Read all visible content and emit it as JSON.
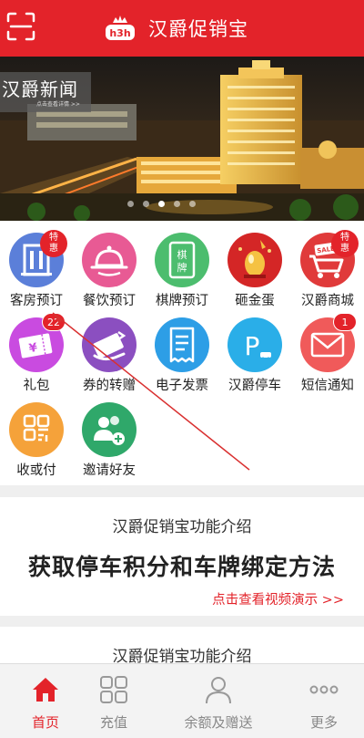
{
  "colors": {
    "brand": "#e3232a",
    "tab_inactive": "#888888"
  },
  "header": {
    "title": "汉爵促销宝",
    "logo_text": "h3h",
    "scan_icon": "scan-icon"
  },
  "banner": {
    "news_title": "汉爵新闻",
    "news_subtitle": "点击查看详情 >>",
    "slide_count": 5,
    "active_slide": 2
  },
  "grid": {
    "items": [
      {
        "label": "客房预订",
        "icon": "hotel-building-icon",
        "color": "#5b7fd9",
        "badge": "特惠"
      },
      {
        "label": "餐饮预订",
        "icon": "food-cloche-icon",
        "color": "#e85a94"
      },
      {
        "label": "棋牌预订",
        "icon": "chess-card-icon",
        "color": "#4cbd6e",
        "icon_text": "棋牌"
      },
      {
        "label": "砸金蛋",
        "icon": "golden-egg-icon",
        "color": "#d42626"
      },
      {
        "label": "汉爵商城",
        "icon": "cart-sale-icon",
        "color": "#e03a3a",
        "badge": "特惠",
        "icon_text": "SALE"
      },
      {
        "label": "礼包",
        "icon": "gift-voucher-icon",
        "color": "#c94be0",
        "badge": "22"
      },
      {
        "label": "券的转赠",
        "icon": "coupon-transfer-icon",
        "color": "#8b4fc0"
      },
      {
        "label": "电子发票",
        "icon": "invoice-icon",
        "color": "#2d9ee6"
      },
      {
        "label": "汉爵停车",
        "icon": "parking-icon",
        "color": "#2aaee8",
        "icon_text": "P"
      },
      {
        "label": "短信通知",
        "icon": "sms-envelope-icon",
        "color": "#f05a5a",
        "badge": "1"
      },
      {
        "label": "收或付",
        "icon": "qr-pay-icon",
        "color": "#f5a23a"
      },
      {
        "label": "邀请好友",
        "icon": "invite-friends-icon",
        "color": "#2fa86a"
      }
    ]
  },
  "promo": {
    "section_title": "汉爵促销宝功能介绍",
    "headline": "获取停车积分和车牌绑定方法",
    "link_text": "点击查看视频演示 >>",
    "next_section_title": "汉爵促销宝功能介绍"
  },
  "tabbar": {
    "tabs": [
      {
        "label": "首页",
        "icon": "home-icon",
        "active": true
      },
      {
        "label": "充值",
        "icon": "grid-apps-icon",
        "active": false
      },
      {
        "label": "余额及赠送",
        "icon": "user-icon",
        "active": false
      },
      {
        "label": "更多",
        "icon": "more-dots-icon",
        "active": false
      }
    ]
  }
}
